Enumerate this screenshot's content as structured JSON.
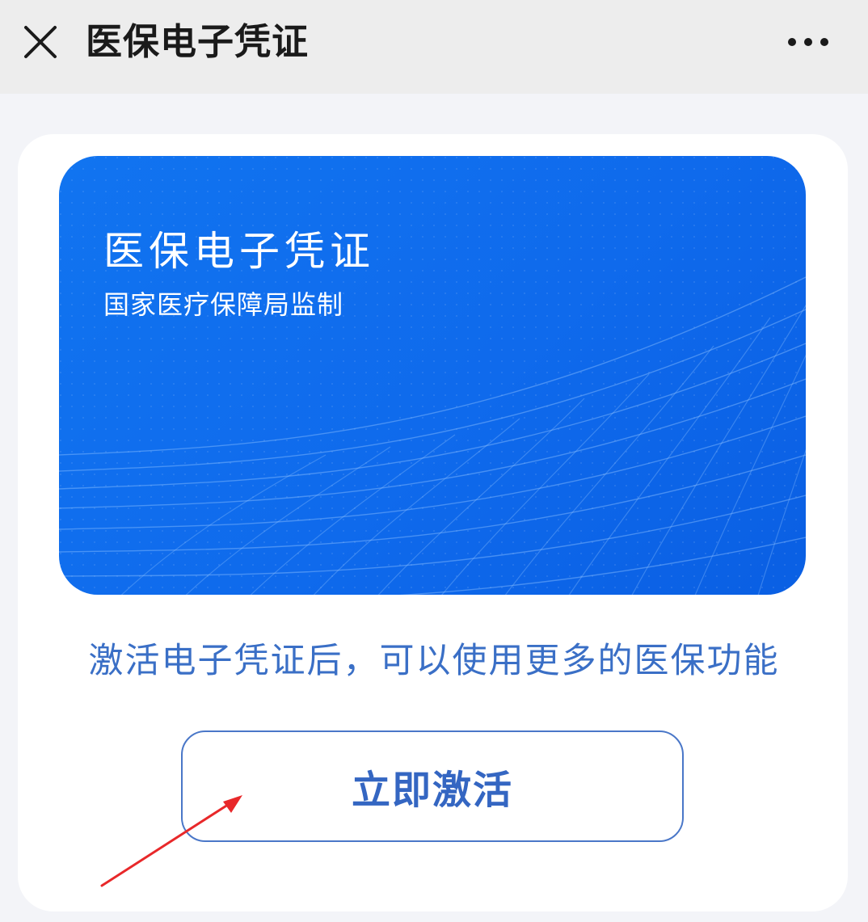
{
  "nav": {
    "title": "医保电子凭证",
    "close_icon": "close-icon",
    "more_icon": "more-dots-icon"
  },
  "card": {
    "title": "医保电子凭证",
    "subtitle": "国家医疗保障局监制",
    "color": "#0f6aec"
  },
  "hint": "激活电子凭证后，可以使用更多的医保功能",
  "activate_button": {
    "label": "立即激活",
    "color": "#3466c2"
  },
  "annotation": {
    "icon": "red-arrow-annotation",
    "color": "#e8282a"
  }
}
